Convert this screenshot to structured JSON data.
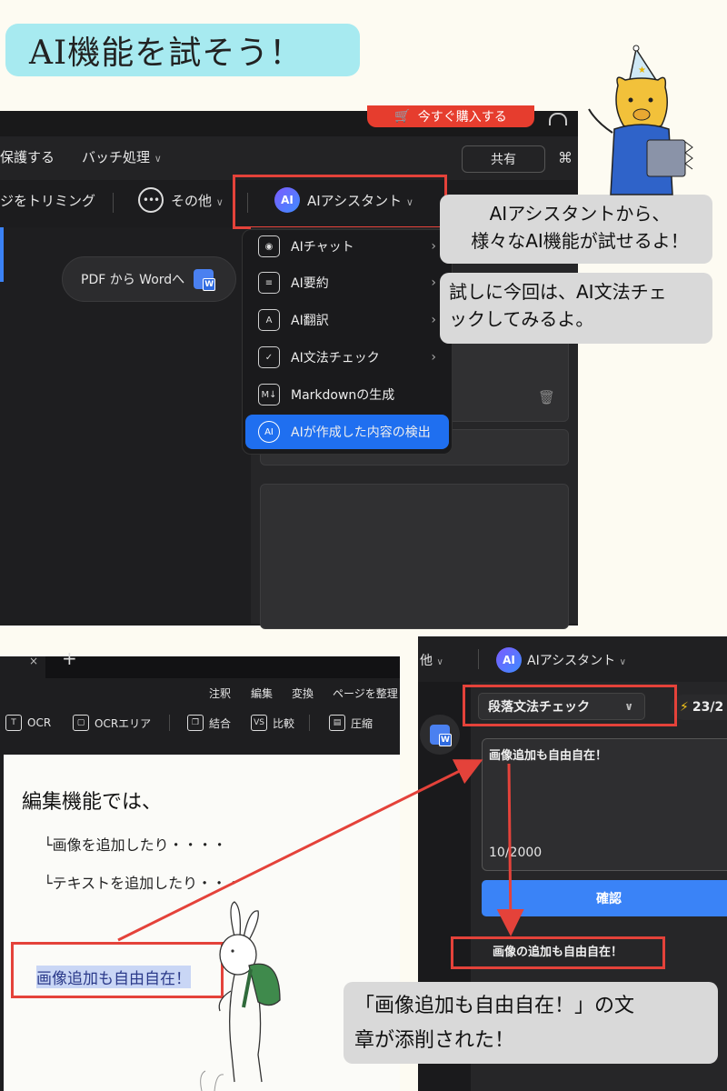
{
  "title": "AI機能を試そう！",
  "colors": {
    "accent_red": "#e4423a",
    "ai_blue": "#1f6ff0",
    "confirm_blue": "#3a83f7"
  },
  "top_shot": {
    "buy_label": "今すぐ購入する",
    "menu": {
      "protect": "保護する",
      "batch": "バッチ処理"
    },
    "share": "共有",
    "toolbar": {
      "trim": "ジをトリミング",
      "more": "その他",
      "ai_assistant": "AIアシスタント"
    },
    "ai_badge": "AI",
    "pdf_to_word": "PDF から Wordへ",
    "dropdown": [
      {
        "label": "AIチャット",
        "icon": "chat-bot-icon",
        "glyph": "◉",
        "arrow": true
      },
      {
        "label": "AI要約",
        "icon": "summary-doc-icon",
        "glyph": "≡",
        "arrow": true
      },
      {
        "label": "AI翻訳",
        "icon": "translate-icon",
        "glyph": "A",
        "arrow": true
      },
      {
        "label": "AI文法チェック",
        "icon": "grammar-check-icon",
        "glyph": "✓",
        "arrow": true
      },
      {
        "label": "Markdownの生成",
        "icon": "markdown-icon",
        "glyph": "M↓",
        "arrow": false
      },
      {
        "label": "AIが作成した内容の検出",
        "icon": "ai-detect-icon",
        "glyph": "AI",
        "arrow": false
      }
    ]
  },
  "bubbles": {
    "b1_line1": "AIアシスタントから、",
    "b1_line2": "様々なAI機能が試せるよ！",
    "b2_line1": "試しに今回は、AI文法チェ",
    "b2_line2": "ックしてみるよ。",
    "b3_line1": "「画像追加も自由自在！」の文",
    "b3_line2": "章が添削された！"
  },
  "editor_shot": {
    "menu": {
      "annotate": "注釈",
      "edit": "編集",
      "convert": "変換",
      "organize": "ページを整理"
    },
    "tools": [
      {
        "label": "OCR",
        "icon": "ocr-icon",
        "glyph": "T"
      },
      {
        "label": "OCRエリア",
        "icon": "ocr-area-icon",
        "glyph": "▢"
      },
      {
        "label": "結合",
        "icon": "merge-icon",
        "glyph": "❐"
      },
      {
        "label": "比較",
        "icon": "compare-icon",
        "glyph": "VS"
      },
      {
        "label": "圧縮",
        "icon": "compress-icon",
        "glyph": "▤"
      }
    ],
    "doc": {
      "heading": "編集機能では、",
      "line1": "└画像を追加したり・・・・",
      "line2": "└テキストを追加したり・・・",
      "highlight": "画像追加も自由自在！"
    }
  },
  "assistant_shot": {
    "more": "他",
    "ai_assistant": "AIアシスタント",
    "ai_badge": "AI",
    "mode": "段落文法チェック",
    "credits": "23/2",
    "input_text": "画像追加も自由自在！",
    "char_count": "10/2000",
    "confirm": "確認",
    "result": "画像の追加も自由自在！"
  }
}
